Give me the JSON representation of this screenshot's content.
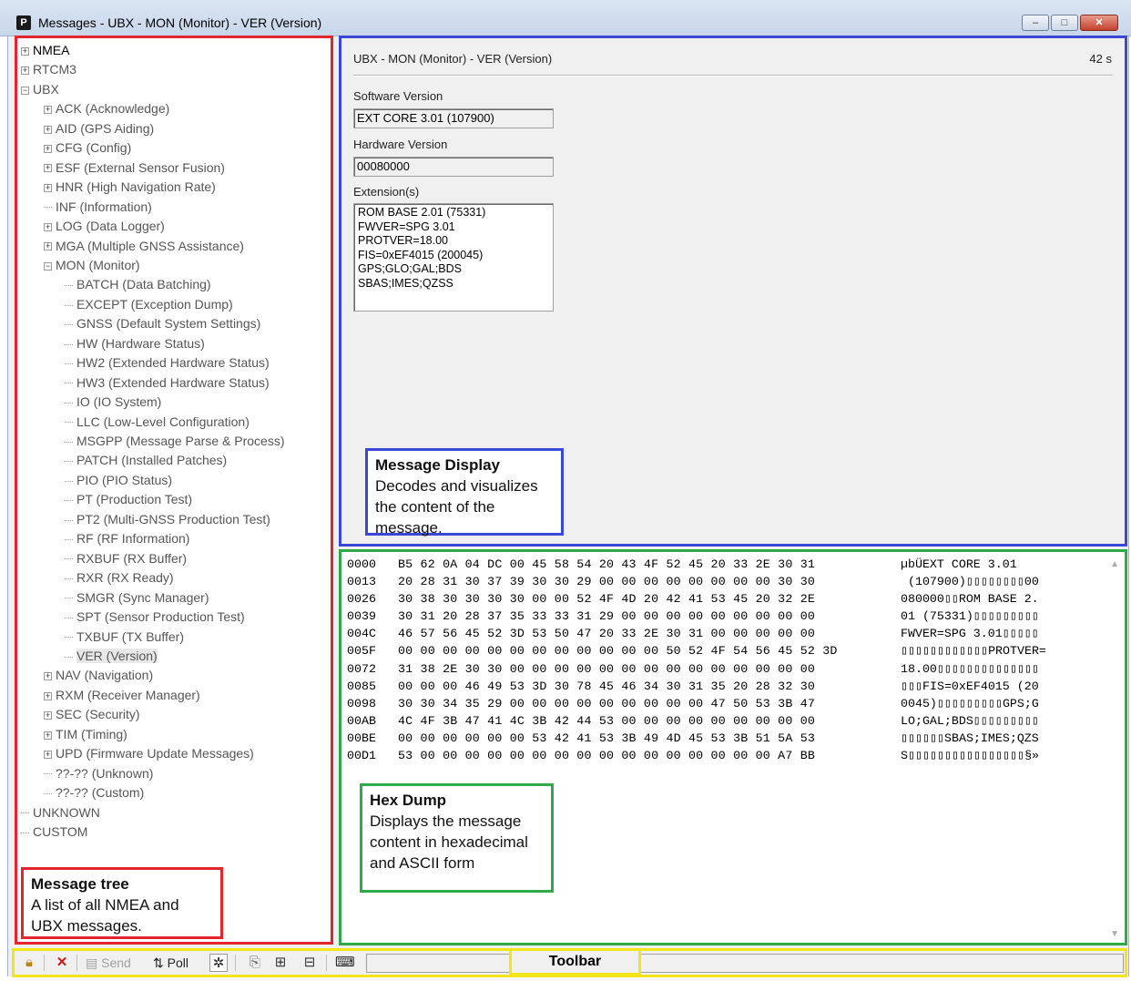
{
  "window": {
    "title": "Messages - UBX - MON (Monitor) - VER (Version)",
    "app_icon": "P",
    "controls": {
      "minimize": "–",
      "maximize": "□",
      "close": "✕"
    }
  },
  "tree": {
    "items": [
      {
        "label": "NMEA",
        "level": 0,
        "expander": "+",
        "strong": true
      },
      {
        "label": "RTCM3",
        "level": 0,
        "expander": "+"
      },
      {
        "label": "UBX",
        "level": 0,
        "expander": "−"
      },
      {
        "label": "ACK (Acknowledge)",
        "level": 1,
        "expander": "+"
      },
      {
        "label": "AID (GPS Aiding)",
        "level": 1,
        "expander": "+"
      },
      {
        "label": "CFG (Config)",
        "level": 1,
        "expander": "+"
      },
      {
        "label": "ESF (External Sensor Fusion)",
        "level": 1,
        "expander": "+"
      },
      {
        "label": "HNR (High Navigation Rate)",
        "level": 1,
        "expander": "+"
      },
      {
        "label": "INF (Information)",
        "level": 1,
        "expander": ""
      },
      {
        "label": "LOG (Data Logger)",
        "level": 1,
        "expander": "+"
      },
      {
        "label": "MGA (Multiple GNSS Assistance)",
        "level": 1,
        "expander": "+"
      },
      {
        "label": "MON (Monitor)",
        "level": 1,
        "expander": "−"
      },
      {
        "label": "BATCH (Data Batching)",
        "level": 2,
        "expander": ""
      },
      {
        "label": "EXCEPT (Exception Dump)",
        "level": 2,
        "expander": ""
      },
      {
        "label": "GNSS (Default System Settings)",
        "level": 2,
        "expander": ""
      },
      {
        "label": "HW (Hardware Status)",
        "level": 2,
        "expander": ""
      },
      {
        "label": "HW2 (Extended Hardware Status)",
        "level": 2,
        "expander": ""
      },
      {
        "label": "HW3 (Extended Hardware Status)",
        "level": 2,
        "expander": ""
      },
      {
        "label": "IO (IO System)",
        "level": 2,
        "expander": ""
      },
      {
        "label": "LLC (Low-Level Configuration)",
        "level": 2,
        "expander": ""
      },
      {
        "label": "MSGPP (Message Parse & Process)",
        "level": 2,
        "expander": ""
      },
      {
        "label": "PATCH (Installed Patches)",
        "level": 2,
        "expander": ""
      },
      {
        "label": "PIO (PIO Status)",
        "level": 2,
        "expander": ""
      },
      {
        "label": "PT (Production Test)",
        "level": 2,
        "expander": ""
      },
      {
        "label": "PT2 (Multi-GNSS Production Test)",
        "level": 2,
        "expander": ""
      },
      {
        "label": "RF (RF Information)",
        "level": 2,
        "expander": ""
      },
      {
        "label": "RXBUF (RX Buffer)",
        "level": 2,
        "expander": ""
      },
      {
        "label": "RXR (RX Ready)",
        "level": 2,
        "expander": ""
      },
      {
        "label": "SMGR (Sync Manager)",
        "level": 2,
        "expander": ""
      },
      {
        "label": "SPT (Sensor Production Test)",
        "level": 2,
        "expander": ""
      },
      {
        "label": "TXBUF (TX Buffer)",
        "level": 2,
        "expander": ""
      },
      {
        "label": "VER (Version)",
        "level": 2,
        "expander": "",
        "selected": true
      },
      {
        "label": "NAV (Navigation)",
        "level": 1,
        "expander": "+"
      },
      {
        "label": "RXM (Receiver Manager)",
        "level": 1,
        "expander": "+"
      },
      {
        "label": "SEC (Security)",
        "level": 1,
        "expander": "+"
      },
      {
        "label": "TIM (Timing)",
        "level": 1,
        "expander": "+"
      },
      {
        "label": "UPD (Firmware Update Messages)",
        "level": 1,
        "expander": "+"
      },
      {
        "label": "??-?? (Unknown)",
        "level": 1,
        "expander": ""
      },
      {
        "label": "??-?? (Custom)",
        "level": 1,
        "expander": ""
      },
      {
        "label": "UNKNOWN",
        "level": 0,
        "expander": ""
      },
      {
        "label": "CUSTOM",
        "level": 0,
        "expander": ""
      }
    ]
  },
  "message": {
    "header": "UBX - MON (Monitor) - VER (Version)",
    "age": "42 s",
    "software_label": "Software Version",
    "software_value": "EXT CORE 3.01 (107900)",
    "hardware_label": "Hardware Version",
    "hardware_value": "00080000",
    "extensions_label": "Extension(s)",
    "extensions": [
      "ROM BASE 2.01 (75331)",
      "FWVER=SPG 3.01",
      "PROTVER=18.00",
      "FIS=0xEF4015 (200045)",
      "GPS;GLO;GAL;BDS",
      "SBAS;IMES;QZSS"
    ]
  },
  "hex": {
    "rows": [
      {
        "offset": "0000",
        "bytes": "B5 62 0A 04 DC 00 45 58 54 20 43 4F 52 45 20 33 2E 30 31",
        "ascii": "µbÜEXT CORE 3.01"
      },
      {
        "offset": "0013",
        "bytes": "20 28 31 30 37 39 30 30 29 00 00 00 00 00 00 00 00 30 30",
        "ascii": " (107900)▯▯▯▯▯▯▯▯00"
      },
      {
        "offset": "0026",
        "bytes": "30 38 30 30 30 30 00 00 52 4F 4D 20 42 41 53 45 20 32 2E",
        "ascii": "080000▯▯ROM BASE 2."
      },
      {
        "offset": "0039",
        "bytes": "30 31 20 28 37 35 33 33 31 29 00 00 00 00 00 00 00 00 00",
        "ascii": "01 (75331)▯▯▯▯▯▯▯▯▯"
      },
      {
        "offset": "004C",
        "bytes": "46 57 56 45 52 3D 53 50 47 20 33 2E 30 31 00 00 00 00 00",
        "ascii": "FWVER=SPG 3.01▯▯▯▯▯"
      },
      {
        "offset": "005F",
        "bytes": "00 00 00 00 00 00 00 00 00 00 00 00 50 52 4F 54 56 45 52 3D",
        "ascii": "▯▯▯▯▯▯▯▯▯▯▯▯PROTVER="
      },
      {
        "offset": "0072",
        "bytes": "31 38 2E 30 30 00 00 00 00 00 00 00 00 00 00 00 00 00 00",
        "ascii": "18.00▯▯▯▯▯▯▯▯▯▯▯▯▯▯"
      },
      {
        "offset": "0085",
        "bytes": "00 00 00 46 49 53 3D 30 78 45 46 34 30 31 35 20 28 32 30",
        "ascii": "▯▯▯FIS=0xEF4015 (20"
      },
      {
        "offset": "0098",
        "bytes": "30 30 34 35 29 00 00 00 00 00 00 00 00 00 47 50 53 3B 47",
        "ascii": "0045)▯▯▯▯▯▯▯▯▯GPS;G"
      },
      {
        "offset": "00AB",
        "bytes": "4C 4F 3B 47 41 4C 3B 42 44 53 00 00 00 00 00 00 00 00 00",
        "ascii": "LO;GAL;BDS▯▯▯▯▯▯▯▯▯"
      },
      {
        "offset": "00BE",
        "bytes": "00 00 00 00 00 00 53 42 41 53 3B 49 4D 45 53 3B 51 5A 53",
        "ascii": "▯▯▯▯▯▯SBAS;IMES;QZS"
      },
      {
        "offset": "00D1",
        "bytes": "53 00 00 00 00 00 00 00 00 00 00 00 00 00 00 00 00 A7 BB",
        "ascii": "S▯▯▯▯▯▯▯▯▯▯▯▯▯▯▯▯§»"
      }
    ]
  },
  "annotations": {
    "tree_title": "Message tree",
    "tree_text": "A list of all NMEA and UBX messages.",
    "display_title": "Message Display",
    "display_text": "Decodes and visualizes the content of the message.",
    "hex_title": "Hex Dump",
    "hex_text": "Displays the message content in hexadecimal and ASCII form",
    "toolbar_label": "Toolbar"
  },
  "toolbar": {
    "send_label": "Send",
    "poll_label": "Poll",
    "icons": [
      "lock-icon",
      "delete-icon",
      "send-icon",
      "poll-icon",
      "tools-icon",
      "copy-icon",
      "expand-icon",
      "collapse-icon",
      "keyboard-icon"
    ]
  }
}
